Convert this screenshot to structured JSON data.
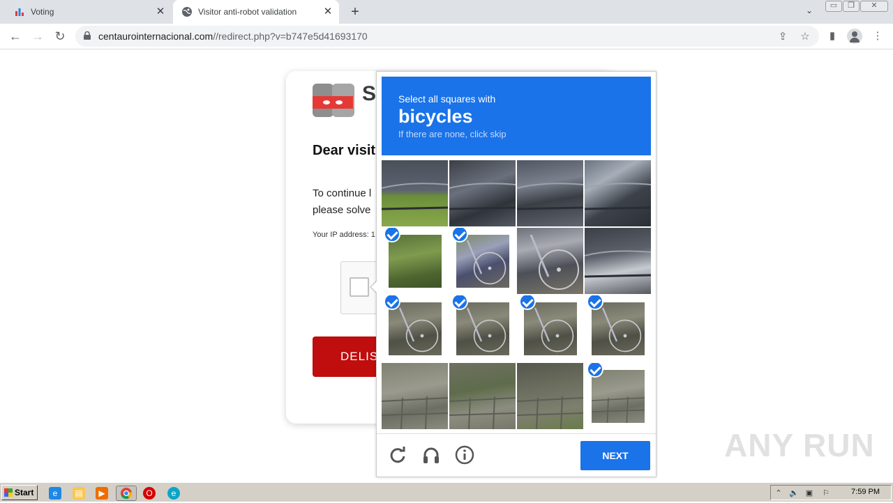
{
  "browser": {
    "tabs": [
      {
        "title": "Voting",
        "active": false
      },
      {
        "title": "Visitor anti-robot validation",
        "active": true
      }
    ],
    "new_tab": "+",
    "url_domain": "centaurointernacional.com",
    "url_path": "//redirect.php?v=b747e5d41693170"
  },
  "page": {
    "logo_letter": "S",
    "greeting": "Dear visit",
    "continue_line1": "To continue l",
    "continue_line2": "please solve",
    "ip_label": "Your IP address: 1",
    "button_label": "DELIS"
  },
  "captcha": {
    "instruction": "Select all squares with",
    "target": "bicycles",
    "hint": "If there are none, click skip",
    "next_label": "NEXT",
    "colors": {
      "accent": "#1a73e8"
    },
    "tiles": [
      {
        "selected": false,
        "scene": "car-door-grass"
      },
      {
        "selected": false,
        "scene": "car-door"
      },
      {
        "selected": false,
        "scene": "car-mirror"
      },
      {
        "selected": false,
        "scene": "car-front"
      },
      {
        "selected": true,
        "scene": "grass"
      },
      {
        "selected": true,
        "scene": "bike-frame"
      },
      {
        "selected": false,
        "scene": "rack-bike"
      },
      {
        "selected": false,
        "scene": "car-wheel"
      },
      {
        "selected": true,
        "scene": "bike-wheel"
      },
      {
        "selected": true,
        "scene": "bike-wheel"
      },
      {
        "selected": true,
        "scene": "bike-wheel"
      },
      {
        "selected": true,
        "scene": "bike-wheel"
      },
      {
        "selected": false,
        "scene": "pavement"
      },
      {
        "selected": false,
        "scene": "pavement-post"
      },
      {
        "selected": false,
        "scene": "pavement-wheel"
      },
      {
        "selected": true,
        "scene": "pavement"
      }
    ]
  },
  "watermark": "ANY RUN",
  "taskbar": {
    "start_label": "Start",
    "clock": "7:59 PM"
  }
}
